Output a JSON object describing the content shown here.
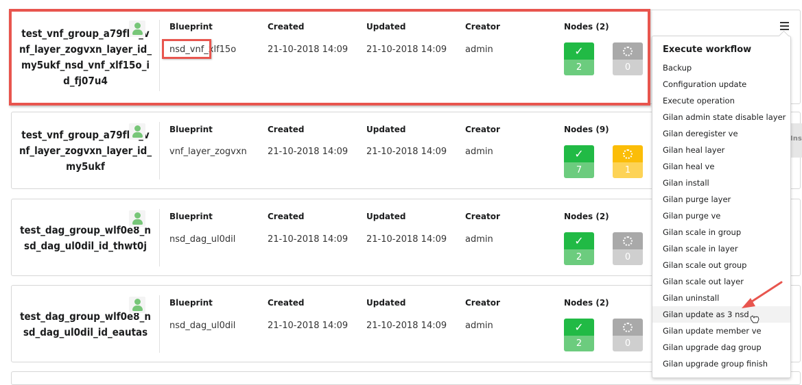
{
  "labels": {
    "blueprint": "Blueprint",
    "created": "Created",
    "updated": "Updated",
    "creator": "Creator"
  },
  "deployments": [
    {
      "name": "test_vnf_group_a79fbc_vnf_layer_zogvxn_layer_id_my5ukf_nsd_vnf_xlf15o_id_fj07u4",
      "blueprint": "nsd_vnf_xlf15o",
      "created": "21-10-2018 14:09",
      "updated": "21-10-2018 14:09",
      "creator": "admin",
      "nodes_label": "Nodes (2)",
      "completed_count": "2",
      "inprogress_count": "0",
      "inprogress_color": "grey"
    },
    {
      "name": "test_vnf_group_a79fbc_vnf_layer_zogvxn_layer_id_my5ukf",
      "blueprint": "vnf_layer_zogvxn",
      "created": "21-10-2018 14:09",
      "updated": "21-10-2018 14:09",
      "creator": "admin",
      "nodes_label": "Nodes (9)",
      "completed_count": "7",
      "inprogress_count": "1",
      "inprogress_color": "yellow"
    },
    {
      "name": "test_dag_group_wlf0e8_nsd_dag_ul0dil_id_thwt0j",
      "blueprint": "nsd_dag_ul0dil",
      "created": "21-10-2018 14:09",
      "updated": "21-10-2018 14:09",
      "creator": "admin",
      "nodes_label": "Nodes (2)",
      "completed_count": "2",
      "inprogress_count": "0",
      "inprogress_color": "grey"
    },
    {
      "name": "test_dag_group_wlf0e8_nsd_dag_ul0dil_id_eautas",
      "blueprint": "nsd_dag_ul0dil",
      "created": "21-10-2018 14:09",
      "updated": "21-10-2018 14:09",
      "creator": "admin",
      "nodes_label": "Nodes (2)",
      "completed_count": "2",
      "inprogress_count": "0",
      "inprogress_color": "grey"
    }
  ],
  "icons": {
    "completed": "check-icon",
    "in_progress": "spinner-icon",
    "user": "user-icon",
    "menu": "hamburger-icon"
  },
  "colors": {
    "annotation": "#e8554e",
    "completed": "#21ba45",
    "pending": "#a9a9a9",
    "warning": "#fbbd08"
  },
  "workflow_menu": {
    "header": "Execute workflow",
    "items": [
      "Backup",
      "Configuration update",
      "Execute operation",
      "Gilan admin state disable layer",
      "Gilan deregister ve",
      "Gilan heal layer",
      "Gilan heal ve",
      "Gilan install",
      "Gilan purge layer",
      "Gilan purge ve",
      "Gilan scale in group",
      "Gilan scale in layer",
      "Gilan scale out group",
      "Gilan scale out layer",
      "Gilan uninstall",
      "Gilan update as 3 nsd",
      "Gilan update member ve",
      "Gilan upgrade dag group",
      "Gilan upgrade group finish"
    ],
    "hovered_item": "Gilan update as 3 nsd"
  },
  "side_hint": "Ins d ×"
}
